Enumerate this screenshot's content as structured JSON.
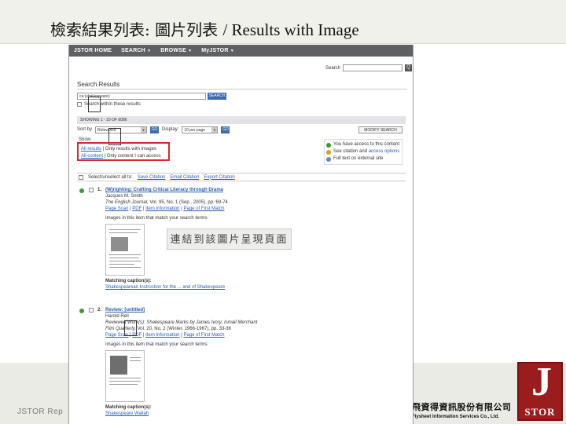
{
  "slide": {
    "title_zh": "檢索結果列表: 圖片列表",
    "title_en": "/ Results with Image",
    "footer_left": "JSTOR Rep",
    "company_zh": "飛資得資訊股份有限公司",
    "company_en": "Flysheet Information Services Co., Ltd.",
    "logo_letter": "J",
    "logo_word": "STOR",
    "accent_color": "#9b1c1c"
  },
  "callout": "連結到該圖片呈現頁面",
  "jstor": {
    "nav": [
      "JSTOR HOME",
      "SEARCH",
      "BROWSE",
      "MyJSTOR"
    ],
    "search_label": "Search",
    "search_go": "Q",
    "results_heading": "Search Results",
    "query_value": "ca:(shakespeare)",
    "query_button": "SEARCH",
    "within_label": "Search within these results",
    "showing": "SHOWING 1 - 10 OF 6086",
    "sort_label": "Sort by",
    "sort_value": "Relevance",
    "display_label": "Display:",
    "display_value": "10 per page",
    "go_label": "GO",
    "modify_label": "MODIFY SEARCH",
    "show_label": "Show:",
    "filter_row1_link": "All results",
    "filter_row1_rest": " | Only results with images",
    "filter_row2_link": "All content",
    "filter_row2_rest": " | Only content I can access",
    "filter_box_color": "#d8272d",
    "legend": [
      {
        "icon": "green-check-icon",
        "text": "You have access to this content"
      },
      {
        "icon": "amber-info-icon",
        "text": "See citation and ",
        "link": "access options"
      },
      {
        "icon": "external-link-icon",
        "text": "Full text on external site"
      }
    ],
    "listbar": {
      "select_label": "Select/unselect all to:",
      "save": "Save Citation",
      "email": "Email Citation",
      "export": "Export Citation"
    },
    "results": [
      {
        "num": "1.",
        "title": "(W)righting: Crafting Critical Literacy through Drama",
        "author": "Jacques M. Smith",
        "journal": "The English Journal,",
        "citation": " Vol. 95, No. 1 (Sep., 2005), pp. 69-74",
        "links": [
          "Page Scan",
          "PDF",
          "Item Information",
          "Page of First Match"
        ],
        "images_label": "Images in this item that match your search terms:",
        "caption_label": "Matching caption(s):",
        "caption": "Shakespearean Instruction for the ... and of Shakespeare"
      },
      {
        "num": "2.",
        "title": "Review: [untitled]",
        "author": "Harold Rell",
        "reviewed": "Reviewed Work(s): Shakespeare Marks by James Ivory; Ismail Merchant",
        "journal": "Film Quarterly,",
        "citation": " Vol. 20, No. 2 (Winter, 1966-1967), pp. 33-36",
        "links": [
          "Page Scan",
          "PDF",
          "Item Information",
          "Page of First Match"
        ],
        "images_label": "Images in this item that match your search terms:",
        "caption_label": "Matching caption(s):",
        "caption": "Shakespeare Wallah"
      }
    ]
  }
}
